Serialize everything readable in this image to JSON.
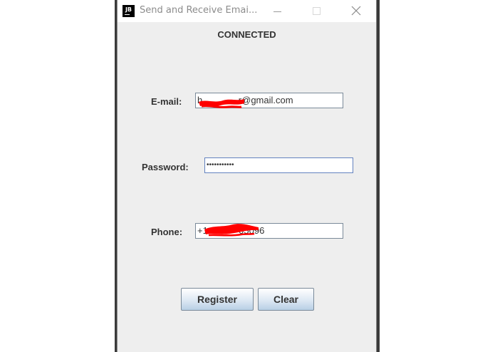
{
  "window": {
    "icon_text": "JB",
    "title": "Send and Receive Emai..."
  },
  "status": "CONNECTED",
  "form": {
    "email_label": "E-mail:",
    "email_value": "h              r@gmail.com",
    "password_label": "Password:",
    "password_value": "•••••••••••",
    "phone_label": "Phone:",
    "phone_value": "+1            05096"
  },
  "buttons": {
    "register": "Register",
    "clear": "Clear"
  },
  "colors": {
    "window_bg": "#eeeeee",
    "redaction": "#ff0000",
    "field_border": "#7a8a99",
    "focused_border": "#6382bf"
  }
}
